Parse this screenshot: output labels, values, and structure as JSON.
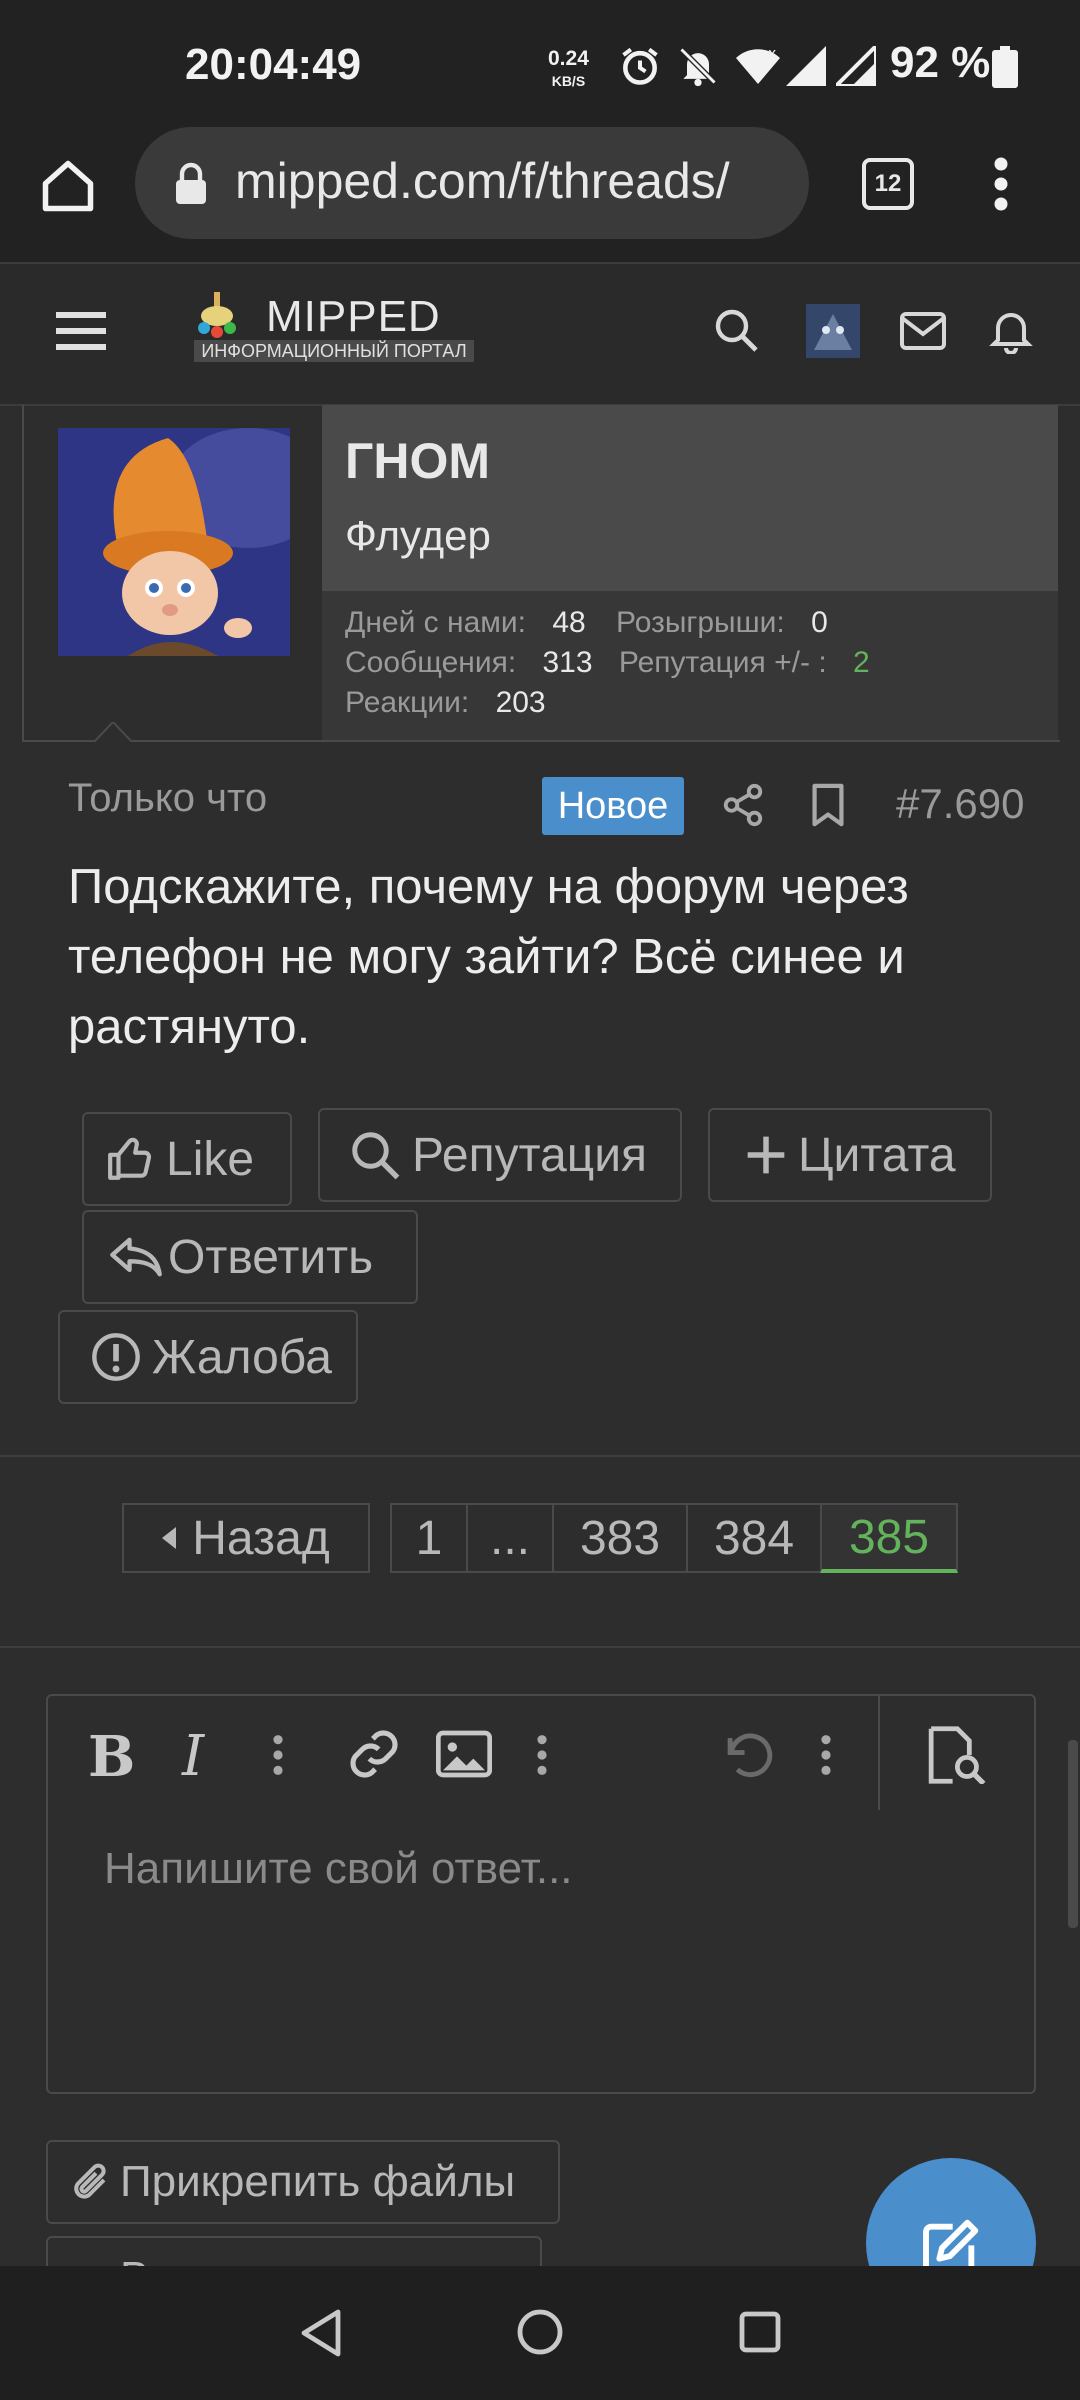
{
  "status_bar": {
    "time": "20:04:49",
    "net_speed_value": "0.24",
    "net_speed_unit": "KB/S",
    "battery": "92 %"
  },
  "browser": {
    "url": "mipped.com/f/threads/",
    "tab_count": "12"
  },
  "site_header": {
    "logo_text": "MIPPED",
    "logo_subtitle": "ИНФОРМАЦИОННЫЙ ПОРТАЛ"
  },
  "user_card": {
    "name": "ГНОМ",
    "title": "Флудер",
    "stats": {
      "days_label": "Дней с нами:",
      "days_value": "48",
      "raffles_label": "Розыгрыши:",
      "raffles_value": "0",
      "messages_label": "Сообщения:",
      "messages_value": "313",
      "reputation_label": "Репутация +/- :",
      "reputation_value": "2",
      "reactions_label": "Реакции:",
      "reactions_value": "203"
    }
  },
  "post": {
    "time": "Только что",
    "badge": "Новое",
    "number": "#7.690",
    "body": "Подскажите, почему на форум через телефон не могу зайти? Всё синее и растянуто."
  },
  "actions": {
    "like": "Like",
    "reputation": "Репутация",
    "quote": "Цитата",
    "reply": "Ответить",
    "report": "Жалоба"
  },
  "pagination": {
    "back": "Назад",
    "pages": [
      "1",
      "...",
      "383",
      "384",
      "385"
    ],
    "current": "385"
  },
  "editor": {
    "placeholder": "Напишите свой ответ..."
  },
  "attachments": {
    "attach_files": "Прикрепить файлы",
    "insert_quotes": "Вставить цитаты..."
  },
  "colors": {
    "accent_blue": "#4a8fcc",
    "accent_green": "#63b35d",
    "background": "#2d2d2d"
  }
}
